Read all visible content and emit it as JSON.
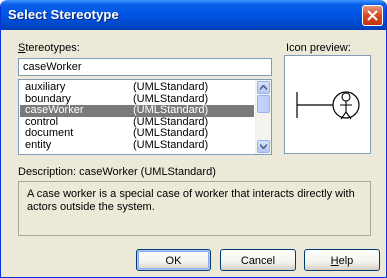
{
  "window": {
    "title": "Select Stereotype"
  },
  "stereotypes_label": {
    "underlined": "S",
    "rest": "tereotypes:"
  },
  "search": {
    "value": "caseWorker"
  },
  "list": {
    "items": [
      {
        "name": "auxiliary",
        "profile": "(UMLStandard)"
      },
      {
        "name": "boundary",
        "profile": "(UMLStandard)"
      },
      {
        "name": "caseWorker",
        "profile": "(UMLStandard)"
      },
      {
        "name": "control",
        "profile": "(UMLStandard)"
      },
      {
        "name": "document",
        "profile": "(UMLStandard)"
      },
      {
        "name": "entity",
        "profile": "(UMLStandard)"
      }
    ],
    "selected_index": 2
  },
  "preview": {
    "label": "Icon preview:",
    "icon": "boundary-actor-icon"
  },
  "description": {
    "heading": "Description: caseWorker (UMLStandard)",
    "text": "A case worker is a special case of worker that interacts directly with actors outside the system."
  },
  "buttons": {
    "ok": "OK",
    "cancel": "Cancel",
    "help_underlined": "H",
    "help_rest": "elp"
  },
  "icons": {
    "close": "close-icon",
    "scroll_up": "scroll-up-icon",
    "scroll_down": "scroll-down-icon"
  },
  "colors": {
    "title_bar": "#0054e3",
    "selection": "#7a7a7a",
    "dialog": "#ece9d8",
    "close": "#d34a23"
  }
}
